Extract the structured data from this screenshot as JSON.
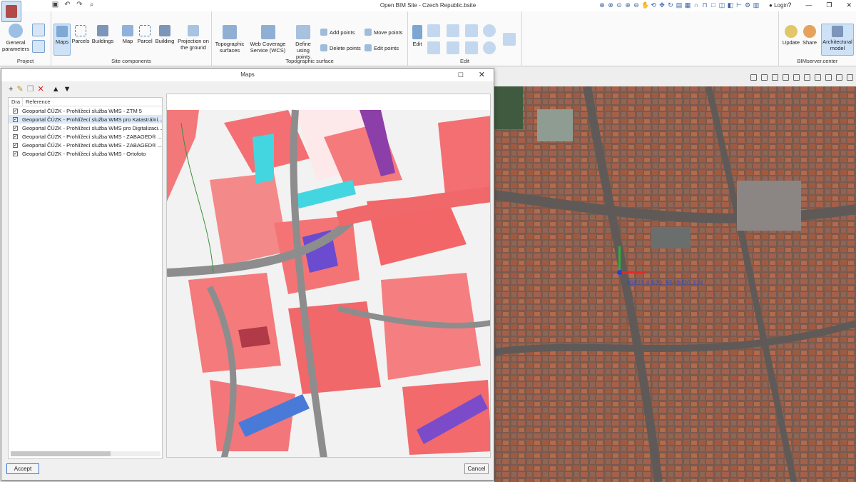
{
  "window": {
    "title": "Open BIM Site - Czech Republic.bsite",
    "login": "Login"
  },
  "ribbon": {
    "groups": {
      "project": "Project",
      "site_components": "Site components",
      "topographic_surface": "Topographic surface",
      "edit": "Edit",
      "bimserver": "BIMserver.center"
    },
    "general_parameters": "General parameters",
    "maps": "Maps",
    "parcels": "Parcels",
    "buildings": "Buildings",
    "map": "Map",
    "parcel": "Parcel",
    "building": "Building",
    "projection": "Projection on the ground",
    "topo_surfaces": "Topographic surfaces",
    "wcs": "Web Coverage Service (WCS)",
    "define_points": "Define using points",
    "add_points": "Add points",
    "delete_points": "Delete points",
    "move_points": "Move points",
    "edit_points": "Edit points",
    "edit": "Edit",
    "update": "Update",
    "share": "Share",
    "architectural_model": "Architectural model"
  },
  "dialog": {
    "title": "Maps",
    "columns": {
      "draw": "Dra",
      "reference": "Reference"
    },
    "rows": [
      {
        "label": "Geoportal ČÚZK - Prohlížecí služba WMS - ZTM 5",
        "checked": true,
        "selected": false
      },
      {
        "label": "Geoportal ČÚZK - Prohlížecí služba WMS pro Katastrální...",
        "checked": true,
        "selected": true
      },
      {
        "label": "Geoportal ČÚZK - Prohlížecí služba WMS pro Digitalizaci...",
        "checked": true,
        "selected": false
      },
      {
        "label": "Geoportal ČÚZK - Prohlížecí služba WMS - ZABAGED® ...",
        "checked": true,
        "selected": false
      },
      {
        "label": "Geoportal ČÚZK - Prohlížecí služba WMS - ZABAGED® ...",
        "checked": true,
        "selected": false
      },
      {
        "label": "Geoportal ČÚZK - Prohlížecí služba WMS - Ortofoto",
        "checked": true,
        "selected": false
      }
    ],
    "accept": "Accept",
    "cancel": "Cancel"
  },
  "viewport": {
    "coordinates": "45823.4.929, 5548430.314"
  }
}
